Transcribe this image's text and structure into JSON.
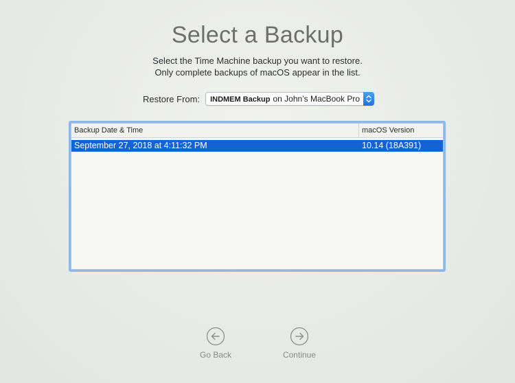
{
  "header": {
    "title": "Select a Backup",
    "subtitle_line1": "Select the Time Machine backup you want to restore.",
    "subtitle_line2": "Only complete backups of macOS appear in the list."
  },
  "restore": {
    "label": "Restore From:",
    "disk_name": "INDMEM Backup",
    "disk_suffix": "on John’s MacBook Pro"
  },
  "table": {
    "columns": [
      "Backup Date & Time",
      "macOS Version"
    ],
    "rows": [
      {
        "date": "September 27, 2018 at 4:11:32 PM",
        "version": "10.14 (18A391)",
        "selected": true
      }
    ]
  },
  "navigation": {
    "back_label": "Go Back",
    "continue_label": "Continue"
  },
  "colors": {
    "selection": "#1463d4",
    "focus_ring": "#8ab8ec",
    "accent": "#1a72e8"
  }
}
